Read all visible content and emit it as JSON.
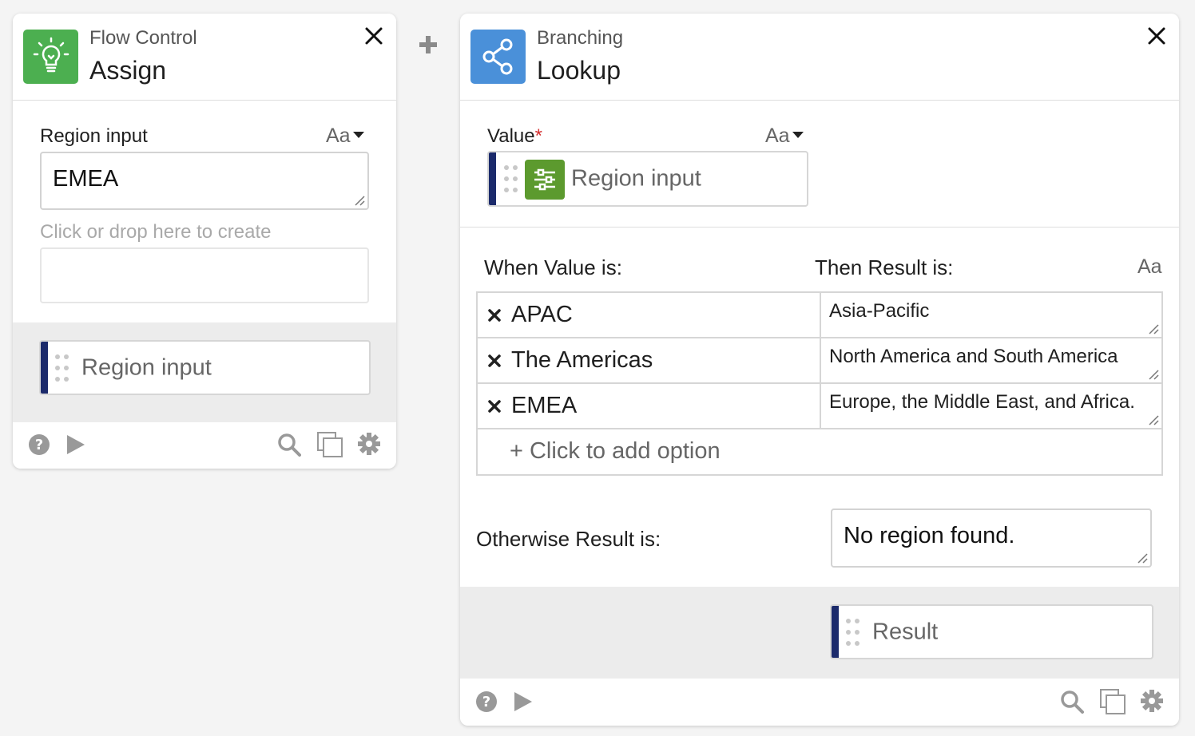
{
  "assign_card": {
    "category": "Flow Control",
    "title": "Assign",
    "icon": "lightbulb-icon",
    "icon_color": "#4caf50",
    "field_label": "Region input",
    "font_toggle": "Aa",
    "field_value": "EMEA",
    "create_hint": "Click or drop here to create",
    "output_pill": "Region input"
  },
  "lookup_card": {
    "category": "Branching",
    "title": "Lookup",
    "icon": "share-icon",
    "icon_color": "#4a90d9",
    "value_label": "Value",
    "required_mark": "*",
    "font_toggle": "Aa",
    "value_pill": "Region input",
    "value_pill_icon_color": "#5c9a2e",
    "when_header": "When Value is:",
    "then_header": "Then Result is:",
    "then_font_toggle": "Aa",
    "rows": [
      {
        "key": "APAC",
        "value": "Asia-Pacific"
      },
      {
        "key": "The Americas",
        "value": "North America and South America"
      },
      {
        "key": "EMEA",
        "value": "Europe, the Middle East, and Africa."
      }
    ],
    "add_option": "+ Click to add option",
    "otherwise_label": "Otherwise Result is:",
    "otherwise_value": "No region found.",
    "result_pill": "Result"
  },
  "colors": {
    "pill_bar": "#1b2a6b",
    "required": "#d32f2f"
  }
}
